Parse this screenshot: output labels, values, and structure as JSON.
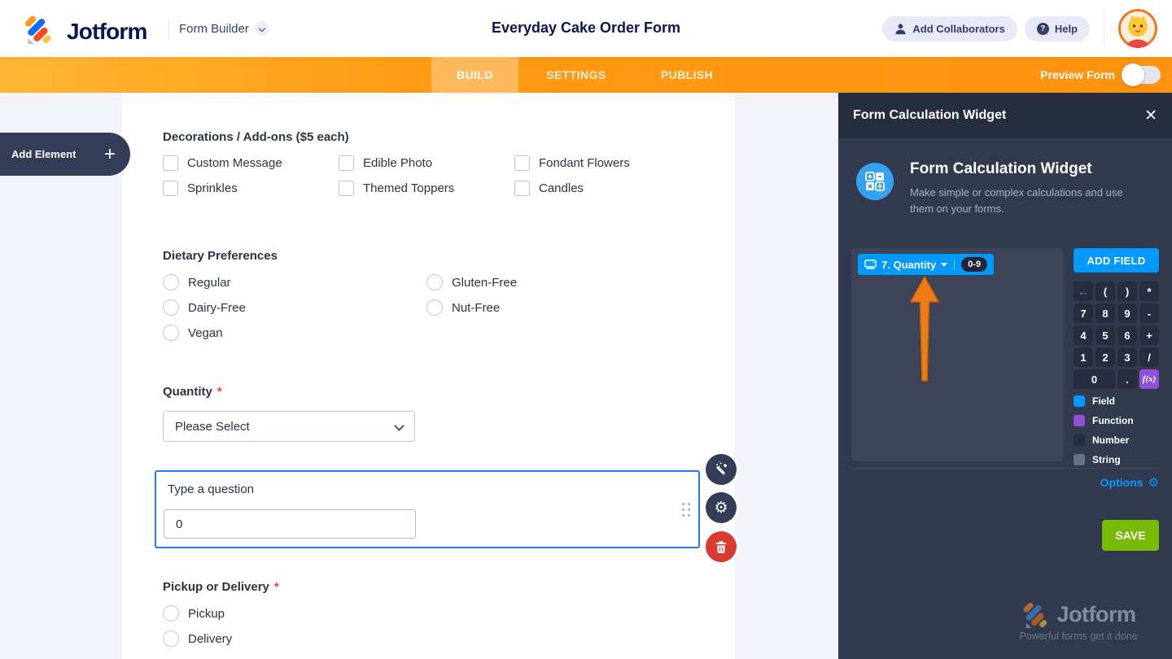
{
  "header": {
    "logo_text": "Jotform",
    "product_label": "Form Builder",
    "form_title": "Everyday Cake Order Form",
    "add_collaborators_label": "Add Collaborators",
    "help_label": "Help"
  },
  "nav": {
    "tabs": [
      {
        "label": "BUILD",
        "active": true
      },
      {
        "label": "SETTINGS",
        "active": false
      },
      {
        "label": "PUBLISH",
        "active": false
      }
    ],
    "preview_label": "Preview Form",
    "preview_toggle_state": "off"
  },
  "sidebar": {
    "add_element_label": "Add Element",
    "plus": "+"
  },
  "form": {
    "decorations": {
      "label": "Decorations / Add-ons ($5 each)",
      "options": [
        "Custom Message",
        "Edible Photo",
        "Fondant Flowers",
        "Sprinkles",
        "Themed Toppers",
        "Candles"
      ]
    },
    "dietary": {
      "label": "Dietary Preferences",
      "col1": [
        "Regular",
        "Dairy-Free",
        "Vegan"
      ],
      "col2": [
        "Gluten-Free",
        "Nut-Free"
      ]
    },
    "quantity": {
      "label": "Quantity",
      "required_mark": "*",
      "selected_value": "Please Select"
    },
    "calc_question": {
      "label": "Type a question",
      "value": "0"
    },
    "pickup": {
      "label": "Pickup or Delivery",
      "required_mark": "*",
      "options": [
        "Pickup",
        "Delivery"
      ]
    }
  },
  "panel": {
    "title": "Form Calculation Widget",
    "close": "✕",
    "widget_title": "Form Calculation Widget",
    "widget_description": "Make simple or complex calculations and use them on your forms.",
    "formula": {
      "chip_label": "7. Quantity",
      "chip_badge": "0-9"
    },
    "add_field_label": "ADD FIELD",
    "keys": [
      "←",
      "(",
      ")",
      "*",
      "7",
      "8",
      "9",
      "-",
      "4",
      "5",
      "6",
      "+",
      "1",
      "2",
      "3",
      "/",
      "0",
      ".",
      "f(x)"
    ],
    "legend": [
      {
        "label": "Field",
        "color": "#0099ff"
      },
      {
        "label": "Function",
        "color": "#9150d8"
      },
      {
        "label": "Number",
        "color": "#272d3f"
      },
      {
        "label": "String",
        "color": "#6a7089"
      }
    ],
    "options_label": "Options",
    "save_label": "SAVE",
    "watermark": {
      "logo_text": "Jotform",
      "tagline": "Powerful forms get it done"
    }
  },
  "colors": {
    "nav_orange": "#ff9210",
    "brand_navy": "#0a1551",
    "panel_bg": "#313a4f",
    "accent_blue": "#0099ff",
    "function_purple": "#9150d8",
    "save_green": "#78bb07",
    "delete_red": "#dc3a30",
    "selection_blue": "#2979ea",
    "arrow_orange": "#ee7c14"
  }
}
